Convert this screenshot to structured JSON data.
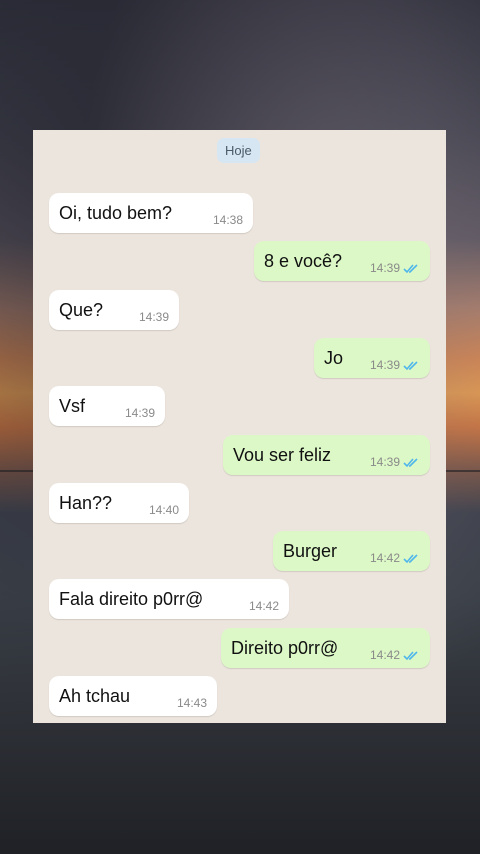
{
  "chat": {
    "date_label": "Hoje",
    "messages": [
      {
        "dir": "in",
        "text": "Oi, tudo bem?",
        "time": "14:38"
      },
      {
        "dir": "out",
        "text": "8 e você?",
        "time": "14:39",
        "status": "read"
      },
      {
        "dir": "in",
        "text": "Que?",
        "time": "14:39"
      },
      {
        "dir": "out",
        "text": "Jo",
        "time": "14:39",
        "status": "read"
      },
      {
        "dir": "in",
        "text": "Vsf",
        "time": "14:39"
      },
      {
        "dir": "out",
        "text": "Vou ser feliz",
        "time": "14:39",
        "status": "read"
      },
      {
        "dir": "in",
        "text": "Han??",
        "time": "14:40"
      },
      {
        "dir": "out",
        "text": "Burger",
        "time": "14:42",
        "status": "read"
      },
      {
        "dir": "in",
        "text": "Fala direito p0rr@",
        "time": "14:42"
      },
      {
        "dir": "out",
        "text": "Direito p0rr@",
        "time": "14:42",
        "status": "read"
      },
      {
        "dir": "in",
        "text": "Ah tchau",
        "time": "14:43"
      }
    ]
  },
  "colors": {
    "chat_background": "#ece5dd",
    "incoming_bubble": "#ffffff",
    "outgoing_bubble": "#dcf8c6",
    "read_ticks": "#4fb6ec",
    "date_chip": "#d6e6f2"
  },
  "icons": {
    "read_status": "double-check-icon"
  }
}
